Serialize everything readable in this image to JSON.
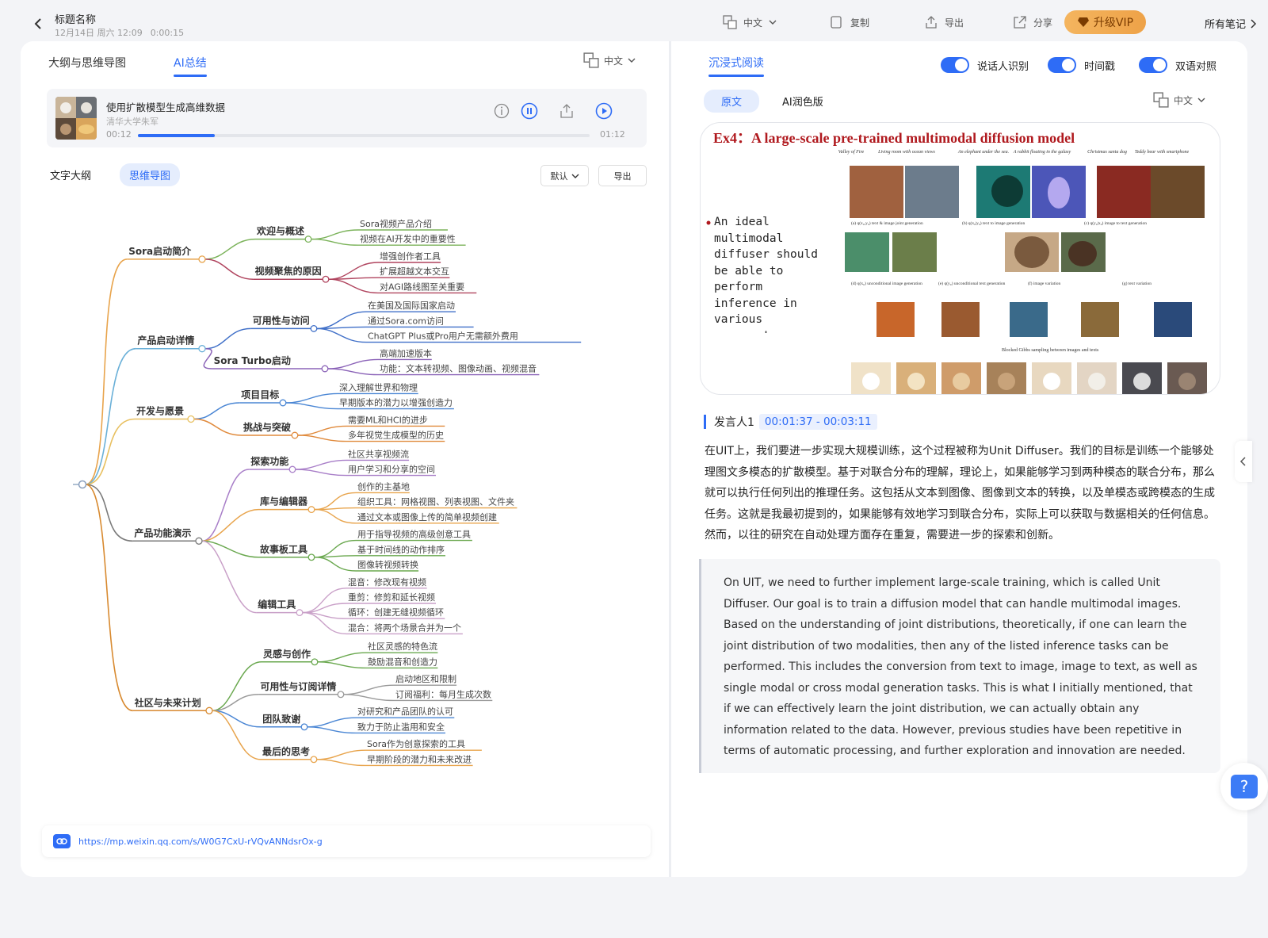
{
  "header": {
    "title": "标题名称",
    "date": "12月14日 周六 12:09",
    "duration": "0:00:15",
    "translate_lang": "中文",
    "copy": "复制",
    "export": "导出",
    "share": "分享",
    "vip": "升级VIP",
    "all_notes": "所有笔记"
  },
  "left": {
    "tabs": [
      "大纲与思维导图",
      "AI总结"
    ],
    "active_tab": "AI总结",
    "lang": "中文",
    "audio": {
      "title": "使用扩散模型生成高维数据",
      "subtitle": "清华大学朱军",
      "current": "00:12",
      "total": "01:12",
      "progress": 0.17
    },
    "view_tabs": [
      "文字大纲",
      "思维导图"
    ],
    "active_view": "思维导图",
    "sort_label": "默认",
    "export_label": "导出",
    "link": "https://mp.weixin.qq.com/s/W0G7CxU-rVQvANNdsrOx-g"
  },
  "mindmap": {
    "branches": [
      {
        "label": "Sora启动简介",
        "color": "#e8a44c",
        "subs": [
          {
            "label": "欢迎与概述",
            "color": "#7bb35a",
            "leaves": [
              "Sora视频产品介绍",
              "视频在AI开发中的重要性"
            ]
          },
          {
            "label": "视频聚焦的原因",
            "color": "#b0445e",
            "leaves": [
              "增强创作者工具",
              "扩展超越文本交互",
              "对AGI路线图至关重要"
            ]
          }
        ]
      },
      {
        "label": "产品启动详情",
        "color": "#6ab0d8",
        "subs": [
          {
            "label": "可用性与访问",
            "color": "#3f6fc8",
            "leaves": [
              "在美国及国际国家启动",
              "通过Sora.com访问",
              "ChatGPT Plus或Pro用户无需额外费用"
            ]
          },
          {
            "label": "Sora Turbo启动",
            "color": "#8b63b8",
            "leaves": [
              "高端加速版本",
              "功能：文本转视频、图像动画、视频混音"
            ]
          }
        ]
      },
      {
        "label": "开发与愿景",
        "color": "#e8c060",
        "subs": [
          {
            "label": "项目目标",
            "color": "#4a86d4",
            "leaves": [
              "深入理解世界和物理",
              "早期版本的潜力以增强创造力"
            ]
          },
          {
            "label": "挑战与突破",
            "color": "#e08a3c",
            "leaves": [
              "需要ML和HCI的进步",
              "多年视觉生成模型的历史"
            ]
          }
        ]
      },
      {
        "label": "产品功能演示",
        "color": "#7a7a7a",
        "subs": [
          {
            "label": "探索功能",
            "color": "#a87ec8",
            "leaves": [
              "社区共享视频流",
              "用户学习和分享的空间"
            ]
          },
          {
            "label": "库与编辑器",
            "color": "#e8a44c",
            "leaves": [
              "创作的主基地",
              "组织工具：网格视图、列表视图、文件夹",
              "通过文本或图像上传的简单视频创建"
            ]
          },
          {
            "label": "故事板工具",
            "color": "#6aa84f",
            "leaves": [
              "用于指导视频的高级创意工具",
              "基于时间线的动作排序",
              "图像转视频转换"
            ]
          },
          {
            "label": "编辑工具",
            "color": "#c9a0c8",
            "leaves": [
              "混音：修改现有视频",
              "重剪：修剪和延长视频",
              "循环：创建无缝视频循环",
              "混合：将两个场景合并为一个"
            ]
          }
        ]
      },
      {
        "label": "社区与未来计划",
        "color": "#d88a30",
        "subs": [
          {
            "label": "灵感与创作",
            "color": "#6aa84f",
            "leaves": [
              "社区灵感的特色流",
              "鼓励混音和创造力"
            ]
          },
          {
            "label": "可用性与订阅详情",
            "color": "#9a9a9a",
            "leaves": [
              "启动地区和限制",
              "订阅福利：每月生成次数"
            ]
          },
          {
            "label": "团队致谢",
            "color": "#4a86d4",
            "leaves": [
              "对研究和产品团队的认可",
              "致力于防止滥用和安全"
            ]
          },
          {
            "label": "最后的思考",
            "color": "#e8a44c",
            "leaves": [
              "Sora作为创意探索的工具",
              "早期阶段的潜力和未来改进"
            ]
          }
        ]
      }
    ]
  },
  "right": {
    "tab": "沉浸式阅读",
    "toggles": [
      "说话人识别",
      "时间戳",
      "双语对照"
    ],
    "sub_tabs": [
      "原文",
      "AI润色版"
    ],
    "active_sub": "原文",
    "lang": "中文",
    "slide": {
      "title": "Ex4：A large-scale pre-trained multimodal diffusion model",
      "bullet": "An ideal multimodal diffuser should be able to perform inference in various manners!",
      "captions": [
        "Valley of Fire",
        "Living room with ocean views",
        "An elephant under the sea.",
        "A rabbit floating in the galaxy",
        "Christmas santa dog",
        "Teddy bear with smartphone"
      ],
      "row1": [
        "(a) q(x₀,y₀) text & image joint generation",
        "(b) q(x₀|y₀) text to image generation",
        "(c) q(y₀|x₀) image to text generation"
      ],
      "row2": [
        "(d) q(x₀) unconditional image generation",
        "(e) q(y₀) unconditional text generation",
        "(f) image variation",
        "(g) text variation"
      ],
      "gibbs": "Blocked Gibbs sampling between images and texts"
    },
    "speaker": "发言人1",
    "timestamp": "00:01:37 - 00:03:11",
    "zh": "在UIT上，我们要进一步实现大规模训练，这个过程被称为Unit Diffuser。我们的目标是训练一个能够处理图文多模态的扩散模型。基于对联合分布的理解，理论上，如果能够学习到两种模态的联合分布，那么就可以执行任何列出的推理任务。这包括从文本到图像、图像到文本的转换，以及单模态或跨模态的生成任务。这就是我最初提到的，如果能够有效地学习到联合分布，实际上可以获取与数据相关的任何信息。然而，以往的研究在自动处理方面存在重复，需要进一步的探索和创新。",
    "en": "On UIT, we need to further implement large-scale training, which is called Unit Diffuser. Our goal is to train a diffusion model that can handle multimodal images. Based on the understanding of joint distributions, theoretically, if one can learn the joint distribution of two modalities, then any of the listed inference tasks can be performed. This includes the conversion from text to image, image to text, as well as single modal or cross modal generation tasks. This is what I initially mentioned, that if we can effectively learn the joint distribution, we can actually obtain any information related to the data. However, previous studies have been repetitive in terms of automatic processing, and further exploration and innovation are needed."
  }
}
